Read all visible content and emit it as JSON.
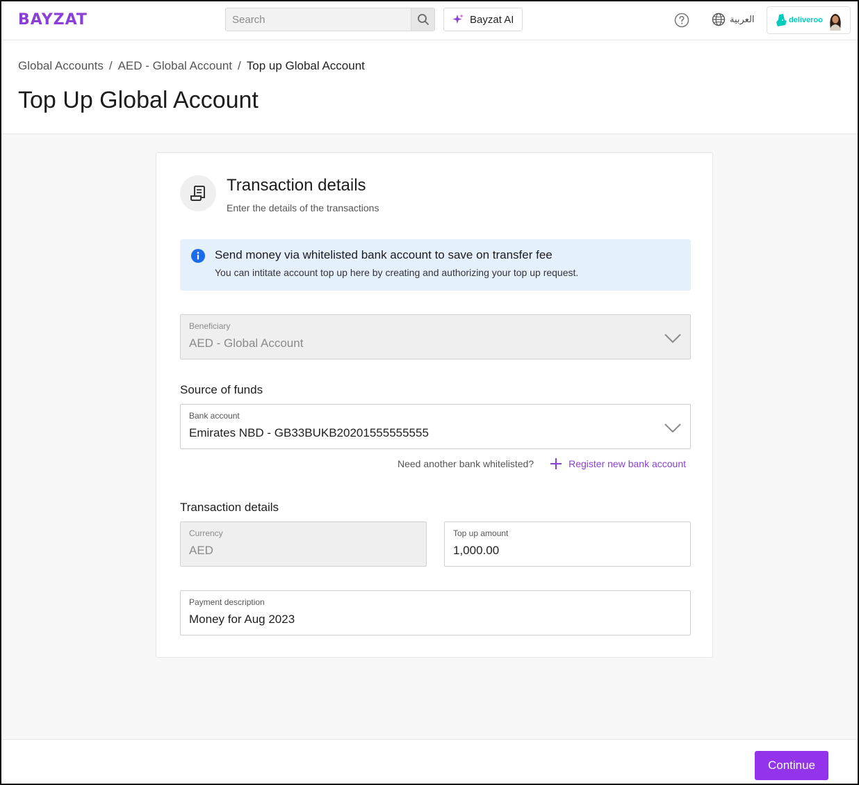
{
  "app": {
    "logo_text": "BAYZAT",
    "brand_color": "#8b3fd9",
    "accent_button_color": "#9333ea"
  },
  "topbar": {
    "search_placeholder": "Search",
    "search_icon": "search-icon",
    "ai_button_label": "Bayzat AI",
    "ai_icon": "sparkle-icon",
    "help_icon": "help-circle-icon",
    "language_label": "العربية",
    "language_icon": "globe-icon",
    "company_name": "deliveroo",
    "company_logo_color": "#00ccbc"
  },
  "breadcrumb": {
    "items": [
      "Global Accounts",
      "AED - Global Account",
      "Top up Global Account"
    ],
    "separator": "/"
  },
  "page": {
    "title": "Top Up Global Account"
  },
  "card": {
    "icon": "receipt-icon",
    "title": "Transaction details",
    "subtitle": "Enter the details of the transactions",
    "info_banner": {
      "icon": "info-icon",
      "title": "Send money via whitelisted bank account to save on transfer fee",
      "text": "You can intitate account top up here by creating and authorizing your top up request.",
      "background": "#e5f0fd"
    },
    "beneficiary": {
      "label": "Beneficiary",
      "value": "AED - Global Account",
      "disabled": true
    },
    "source_heading": "Source of funds",
    "bank_account": {
      "label": "Bank account",
      "value": "Emirates NBD - GB33BUKB20201555555555"
    },
    "whitelist_question": "Need another bank whitelisted?",
    "register_link": "Register new bank account",
    "transaction_heading": "Transaction details",
    "currency": {
      "label": "Currency",
      "value": "AED",
      "disabled": true
    },
    "top_up_amount": {
      "label": "Top up amount",
      "value": "1,000.00"
    },
    "payment_description": {
      "label": "Payment description",
      "value": "Money for Aug 2023"
    }
  },
  "footer": {
    "continue_label": "Continue"
  }
}
